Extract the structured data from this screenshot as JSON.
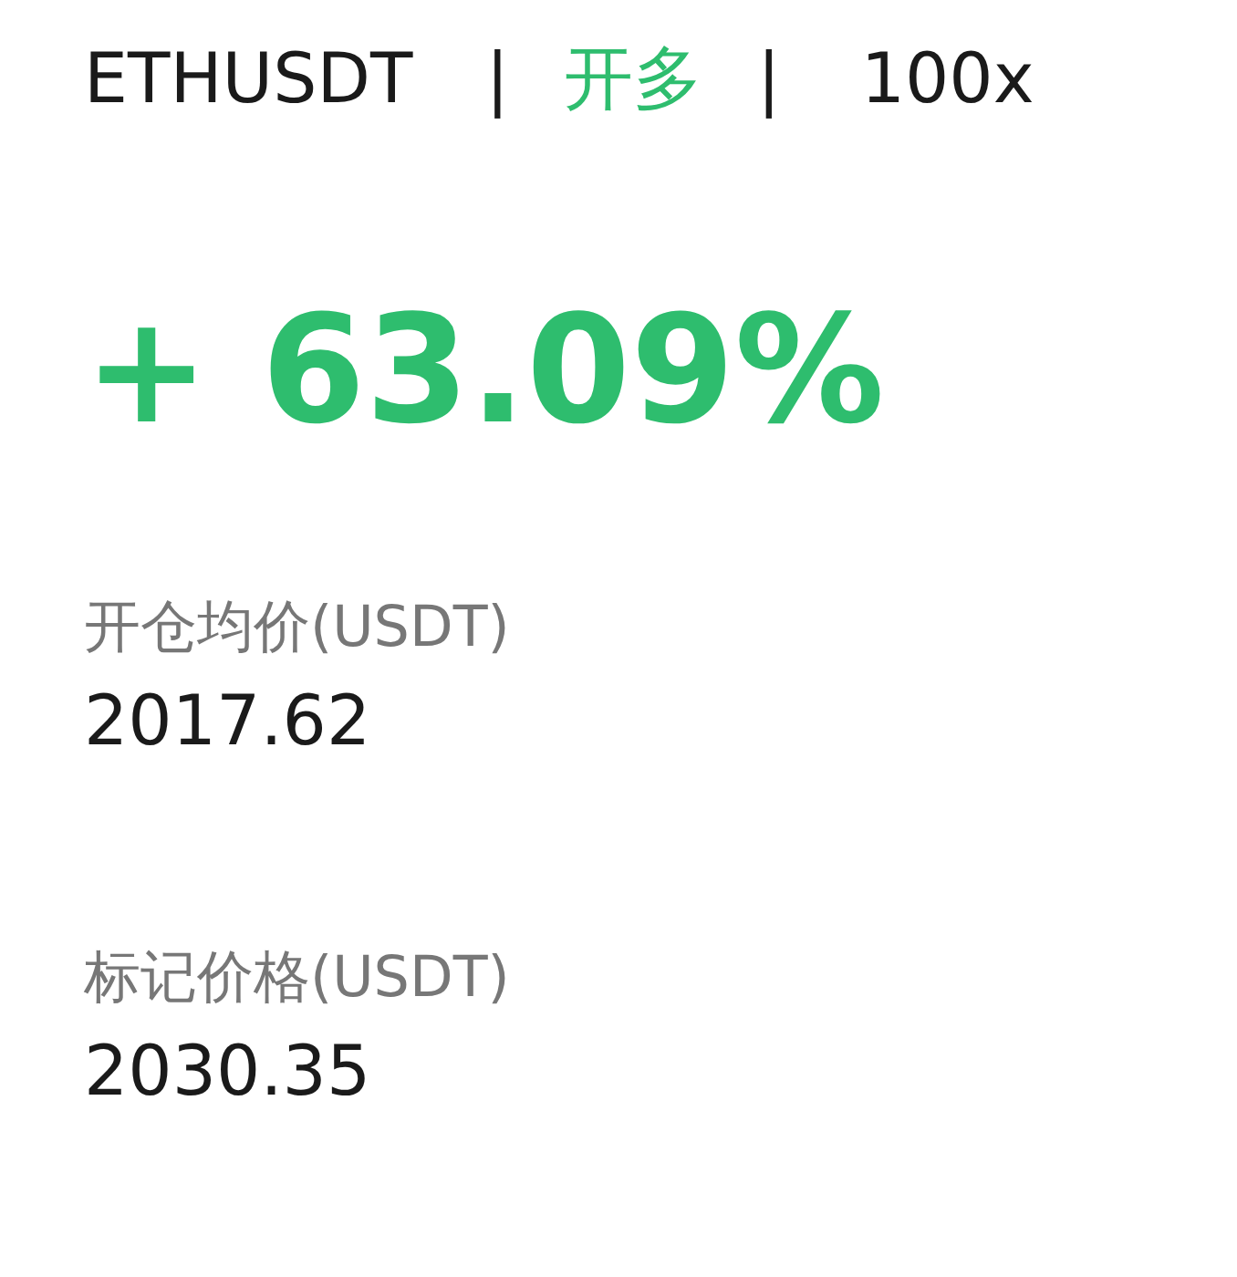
{
  "position": {
    "symbol": "ETHUSDT",
    "separator_1": "|",
    "side": {
      "label": "开多",
      "kind": "long"
    },
    "separator_2": "|",
    "leverage": "100x"
  },
  "pnl": {
    "text": "+ 63.09%"
  },
  "fields": [
    {
      "label": "开仓均价(USDT)",
      "value": "2017.62"
    },
    {
      "label": "标记价格(USDT)",
      "value": "2030.35"
    }
  ]
}
